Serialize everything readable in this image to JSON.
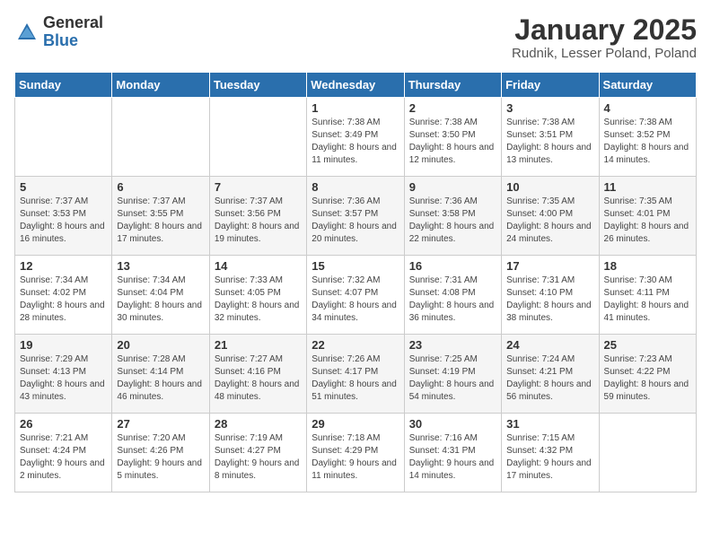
{
  "logo": {
    "general": "General",
    "blue": "Blue"
  },
  "title": "January 2025",
  "location": "Rudnik, Lesser Poland, Poland",
  "weekdays": [
    "Sunday",
    "Monday",
    "Tuesday",
    "Wednesday",
    "Thursday",
    "Friday",
    "Saturday"
  ],
  "weeks": [
    [
      {
        "day": "",
        "sunrise": "",
        "sunset": "",
        "daylight": ""
      },
      {
        "day": "",
        "sunrise": "",
        "sunset": "",
        "daylight": ""
      },
      {
        "day": "",
        "sunrise": "",
        "sunset": "",
        "daylight": ""
      },
      {
        "day": "1",
        "sunrise": "Sunrise: 7:38 AM",
        "sunset": "Sunset: 3:49 PM",
        "daylight": "Daylight: 8 hours and 11 minutes."
      },
      {
        "day": "2",
        "sunrise": "Sunrise: 7:38 AM",
        "sunset": "Sunset: 3:50 PM",
        "daylight": "Daylight: 8 hours and 12 minutes."
      },
      {
        "day": "3",
        "sunrise": "Sunrise: 7:38 AM",
        "sunset": "Sunset: 3:51 PM",
        "daylight": "Daylight: 8 hours and 13 minutes."
      },
      {
        "day": "4",
        "sunrise": "Sunrise: 7:38 AM",
        "sunset": "Sunset: 3:52 PM",
        "daylight": "Daylight: 8 hours and 14 minutes."
      }
    ],
    [
      {
        "day": "5",
        "sunrise": "Sunrise: 7:37 AM",
        "sunset": "Sunset: 3:53 PM",
        "daylight": "Daylight: 8 hours and 16 minutes."
      },
      {
        "day": "6",
        "sunrise": "Sunrise: 7:37 AM",
        "sunset": "Sunset: 3:55 PM",
        "daylight": "Daylight: 8 hours and 17 minutes."
      },
      {
        "day": "7",
        "sunrise": "Sunrise: 7:37 AM",
        "sunset": "Sunset: 3:56 PM",
        "daylight": "Daylight: 8 hours and 19 minutes."
      },
      {
        "day": "8",
        "sunrise": "Sunrise: 7:36 AM",
        "sunset": "Sunset: 3:57 PM",
        "daylight": "Daylight: 8 hours and 20 minutes."
      },
      {
        "day": "9",
        "sunrise": "Sunrise: 7:36 AM",
        "sunset": "Sunset: 3:58 PM",
        "daylight": "Daylight: 8 hours and 22 minutes."
      },
      {
        "day": "10",
        "sunrise": "Sunrise: 7:35 AM",
        "sunset": "Sunset: 4:00 PM",
        "daylight": "Daylight: 8 hours and 24 minutes."
      },
      {
        "day": "11",
        "sunrise": "Sunrise: 7:35 AM",
        "sunset": "Sunset: 4:01 PM",
        "daylight": "Daylight: 8 hours and 26 minutes."
      }
    ],
    [
      {
        "day": "12",
        "sunrise": "Sunrise: 7:34 AM",
        "sunset": "Sunset: 4:02 PM",
        "daylight": "Daylight: 8 hours and 28 minutes."
      },
      {
        "day": "13",
        "sunrise": "Sunrise: 7:34 AM",
        "sunset": "Sunset: 4:04 PM",
        "daylight": "Daylight: 8 hours and 30 minutes."
      },
      {
        "day": "14",
        "sunrise": "Sunrise: 7:33 AM",
        "sunset": "Sunset: 4:05 PM",
        "daylight": "Daylight: 8 hours and 32 minutes."
      },
      {
        "day": "15",
        "sunrise": "Sunrise: 7:32 AM",
        "sunset": "Sunset: 4:07 PM",
        "daylight": "Daylight: 8 hours and 34 minutes."
      },
      {
        "day": "16",
        "sunrise": "Sunrise: 7:31 AM",
        "sunset": "Sunset: 4:08 PM",
        "daylight": "Daylight: 8 hours and 36 minutes."
      },
      {
        "day": "17",
        "sunrise": "Sunrise: 7:31 AM",
        "sunset": "Sunset: 4:10 PM",
        "daylight": "Daylight: 8 hours and 38 minutes."
      },
      {
        "day": "18",
        "sunrise": "Sunrise: 7:30 AM",
        "sunset": "Sunset: 4:11 PM",
        "daylight": "Daylight: 8 hours and 41 minutes."
      }
    ],
    [
      {
        "day": "19",
        "sunrise": "Sunrise: 7:29 AM",
        "sunset": "Sunset: 4:13 PM",
        "daylight": "Daylight: 8 hours and 43 minutes."
      },
      {
        "day": "20",
        "sunrise": "Sunrise: 7:28 AM",
        "sunset": "Sunset: 4:14 PM",
        "daylight": "Daylight: 8 hours and 46 minutes."
      },
      {
        "day": "21",
        "sunrise": "Sunrise: 7:27 AM",
        "sunset": "Sunset: 4:16 PM",
        "daylight": "Daylight: 8 hours and 48 minutes."
      },
      {
        "day": "22",
        "sunrise": "Sunrise: 7:26 AM",
        "sunset": "Sunset: 4:17 PM",
        "daylight": "Daylight: 8 hours and 51 minutes."
      },
      {
        "day": "23",
        "sunrise": "Sunrise: 7:25 AM",
        "sunset": "Sunset: 4:19 PM",
        "daylight": "Daylight: 8 hours and 54 minutes."
      },
      {
        "day": "24",
        "sunrise": "Sunrise: 7:24 AM",
        "sunset": "Sunset: 4:21 PM",
        "daylight": "Daylight: 8 hours and 56 minutes."
      },
      {
        "day": "25",
        "sunrise": "Sunrise: 7:23 AM",
        "sunset": "Sunset: 4:22 PM",
        "daylight": "Daylight: 8 hours and 59 minutes."
      }
    ],
    [
      {
        "day": "26",
        "sunrise": "Sunrise: 7:21 AM",
        "sunset": "Sunset: 4:24 PM",
        "daylight": "Daylight: 9 hours and 2 minutes."
      },
      {
        "day": "27",
        "sunrise": "Sunrise: 7:20 AM",
        "sunset": "Sunset: 4:26 PM",
        "daylight": "Daylight: 9 hours and 5 minutes."
      },
      {
        "day": "28",
        "sunrise": "Sunrise: 7:19 AM",
        "sunset": "Sunset: 4:27 PM",
        "daylight": "Daylight: 9 hours and 8 minutes."
      },
      {
        "day": "29",
        "sunrise": "Sunrise: 7:18 AM",
        "sunset": "Sunset: 4:29 PM",
        "daylight": "Daylight: 9 hours and 11 minutes."
      },
      {
        "day": "30",
        "sunrise": "Sunrise: 7:16 AM",
        "sunset": "Sunset: 4:31 PM",
        "daylight": "Daylight: 9 hours and 14 minutes."
      },
      {
        "day": "31",
        "sunrise": "Sunrise: 7:15 AM",
        "sunset": "Sunset: 4:32 PM",
        "daylight": "Daylight: 9 hours and 17 minutes."
      },
      {
        "day": "",
        "sunrise": "",
        "sunset": "",
        "daylight": ""
      }
    ]
  ]
}
